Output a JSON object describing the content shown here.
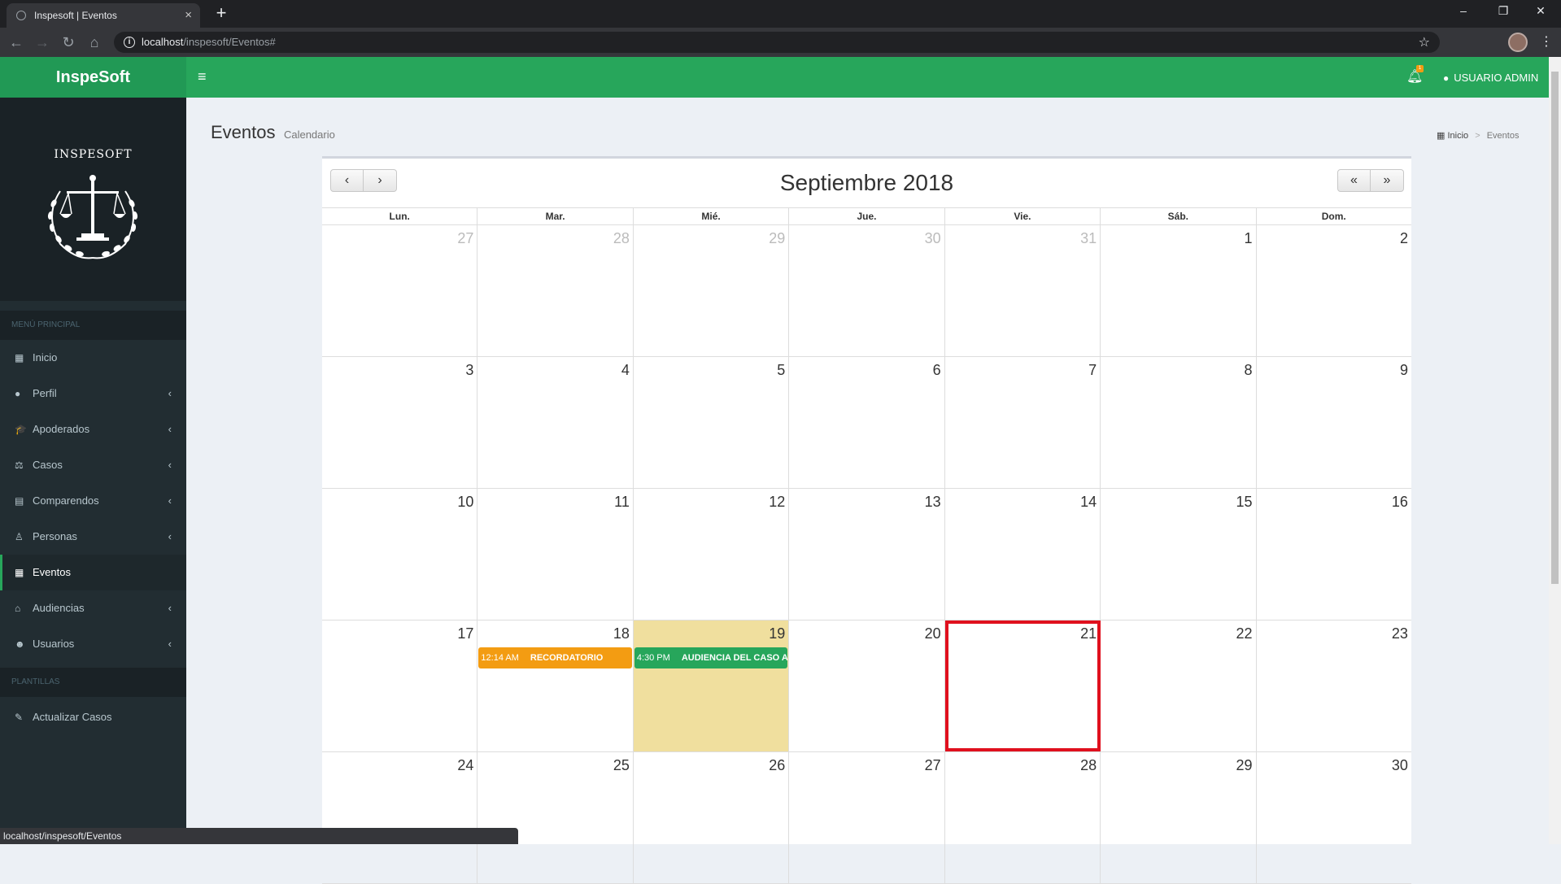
{
  "browser": {
    "tab_title": "Inspesoft | Eventos",
    "tab_close": "×",
    "new_tab": "+",
    "url_host": "localhost",
    "url_path": "/inspesoft/Eventos#",
    "status_url": "localhost/inspesoft/Eventos",
    "minimize": "–",
    "maximize": "❐",
    "close": "✕"
  },
  "app": {
    "brand_bold": "Inspe",
    "brand_rest": "Soft",
    "hamburger": "≡",
    "notification_count": "1",
    "user_name": "USUARIO ADMIN",
    "accent_color": "#27a65b",
    "sidebar_color": "#222d32"
  },
  "sidebar": {
    "logo_text": "INSPESOFT",
    "header_main": "MENÚ PRINCIPAL",
    "header_templates": "PLANTILLAS",
    "items": [
      {
        "label": "Inicio",
        "icon": "grid-icon",
        "glyph": "▦",
        "chevron": false
      },
      {
        "label": "Perfil",
        "icon": "user-icon",
        "glyph": "●",
        "chevron": true
      },
      {
        "label": "Apoderados",
        "icon": "graduation-cap-icon",
        "glyph": "🎓",
        "chevron": true
      },
      {
        "label": "Casos",
        "icon": "balance-scale-icon",
        "glyph": "⚖",
        "chevron": true
      },
      {
        "label": "Comparendos",
        "icon": "file-icon",
        "glyph": "▤",
        "chevron": true
      },
      {
        "label": "Personas",
        "icon": "male-icon",
        "glyph": "♙",
        "chevron": true
      },
      {
        "label": "Eventos",
        "icon": "calendar-icon",
        "glyph": "▦",
        "chevron": false
      },
      {
        "label": "Audiencias",
        "icon": "bank-icon",
        "glyph": "⌂",
        "chevron": true
      },
      {
        "label": "Usuarios",
        "icon": "users-icon",
        "glyph": "☻",
        "chevron": true
      }
    ],
    "template_items": [
      {
        "label": "Actualizar Casos",
        "icon": "edit-icon",
        "glyph": "✎"
      }
    ],
    "chevron_glyph": "‹"
  },
  "page": {
    "title": "Eventos",
    "subtitle": "Calendario",
    "breadcrumb_home": "Inicio",
    "breadcrumb_sep": ">",
    "breadcrumb_current": "Eventos"
  },
  "calendar": {
    "title": "Septiembre 2018",
    "prev": "‹",
    "next": "›",
    "prev_year": "«",
    "next_year": "»",
    "days_of_week": [
      "Lun.",
      "Mar.",
      "Mié.",
      "Jue.",
      "Vie.",
      "Sáb.",
      "Dom."
    ],
    "weeks": [
      [
        {
          "d": "27",
          "o": true
        },
        {
          "d": "28",
          "o": true
        },
        {
          "d": "29",
          "o": true
        },
        {
          "d": "30",
          "o": true
        },
        {
          "d": "31",
          "o": true
        },
        {
          "d": "1"
        },
        {
          "d": "2"
        }
      ],
      [
        {
          "d": "3"
        },
        {
          "d": "4"
        },
        {
          "d": "5"
        },
        {
          "d": "6"
        },
        {
          "d": "7"
        },
        {
          "d": "8"
        },
        {
          "d": "9"
        }
      ],
      [
        {
          "d": "10"
        },
        {
          "d": "11"
        },
        {
          "d": "12"
        },
        {
          "d": "13"
        },
        {
          "d": "14"
        },
        {
          "d": "15"
        },
        {
          "d": "16"
        }
      ],
      [
        {
          "d": "17"
        },
        {
          "d": "18"
        },
        {
          "d": "19",
          "today": true
        },
        {
          "d": "20"
        },
        {
          "d": "21",
          "selected": true
        },
        {
          "d": "22"
        },
        {
          "d": "23"
        }
      ],
      [
        {
          "d": "24"
        },
        {
          "d": "25"
        },
        {
          "d": "26"
        },
        {
          "d": "27"
        },
        {
          "d": "28"
        },
        {
          "d": "29"
        },
        {
          "d": "30"
        }
      ]
    ],
    "events": [
      {
        "day": "18",
        "time": "12:14 AM",
        "title": "RECORDATORIO",
        "color": "#f39c12"
      },
      {
        "day": "19",
        "time": "4:30 PM",
        "title": "AUDIENCIA DEL CASO AMEN",
        "color": "#27a65b"
      }
    ],
    "today_color": "#f0df9e",
    "selected_color": "#e0101e"
  }
}
